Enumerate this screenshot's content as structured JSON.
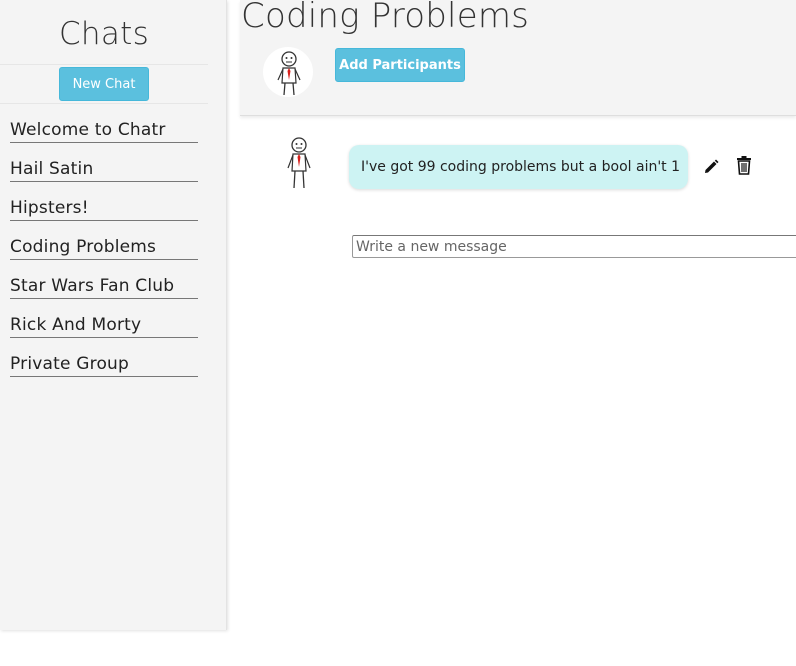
{
  "sidebar": {
    "title": "Chats",
    "new_chat_label": "New Chat",
    "items": [
      {
        "label": "Welcome to Chatr"
      },
      {
        "label": "Hail Satin"
      },
      {
        "label": "Hipsters!"
      },
      {
        "label": "Coding Problems"
      },
      {
        "label": "Star Wars Fan Club"
      },
      {
        "label": "Rick And Morty"
      },
      {
        "label": "Private Group"
      }
    ]
  },
  "header": {
    "title": "Coding Problems",
    "add_participants_label": "Add Participants",
    "avatar_icon": "stick-figure-avatar-icon"
  },
  "messages": [
    {
      "text": "I've got 99 coding problems but a bool ain't 1",
      "avatar_icon": "stick-figure-avatar-icon",
      "actions": [
        "pencil-icon",
        "trash-icon"
      ]
    }
  ],
  "composer": {
    "placeholder": "Write a new message"
  },
  "colors": {
    "accent": "#5bc0de",
    "bubble": "#cdf3f3",
    "panel": "#f4f4f4",
    "tie": "#d9201b"
  }
}
